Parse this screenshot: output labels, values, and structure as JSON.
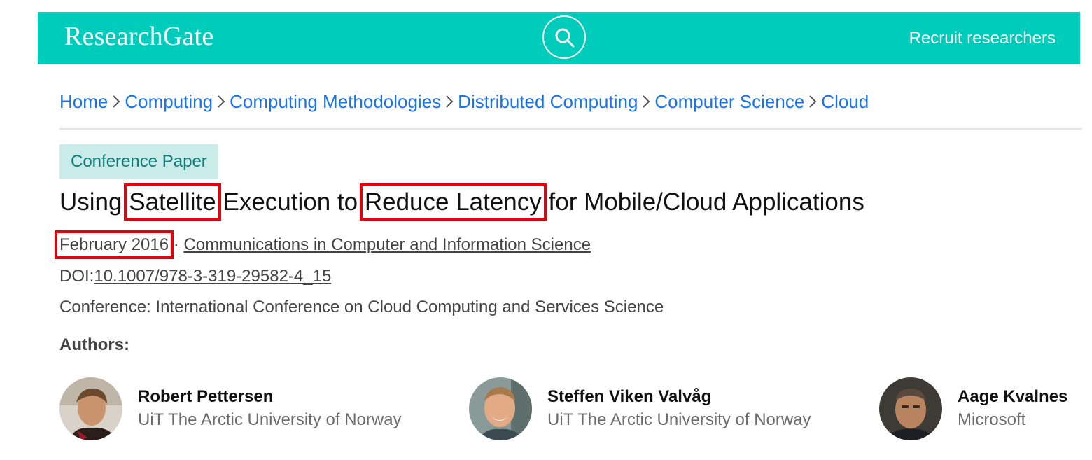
{
  "header": {
    "logo": "ResearchGate",
    "search_icon": "search-icon",
    "recruit_label": "Recruit researchers",
    "color": "#00ccbb"
  },
  "breadcrumb": [
    "Home",
    "Computing",
    "Computing Methodologies",
    "Distributed Computing",
    "Computer Science",
    "Cloud"
  ],
  "paper": {
    "type_badge": "Conference Paper",
    "title_parts": [
      "Using ",
      "Satellite",
      " Execution to ",
      "Reduce Latency",
      " for Mobile/Cloud Applications"
    ],
    "date": "February 2016",
    "date_separator": " · ",
    "journal": "Communications in Computer and Information Science",
    "doi_label": "DOI:",
    "doi": "10.1007/978-3-319-29582-4_15",
    "conference": "Conference: International Conference on Cloud Computing and Services Science",
    "highlight_color": "#e3000f"
  },
  "authors_label": "Authors:",
  "authors": [
    {
      "name": "Robert Pettersen",
      "affiliation": "UiT The Arctic University of Norway"
    },
    {
      "name": "Steffen Viken Valvåg",
      "affiliation": "UiT The Arctic University of Norway"
    },
    {
      "name": "Aage Kvalnes",
      "affiliation": "Microsoft"
    }
  ]
}
